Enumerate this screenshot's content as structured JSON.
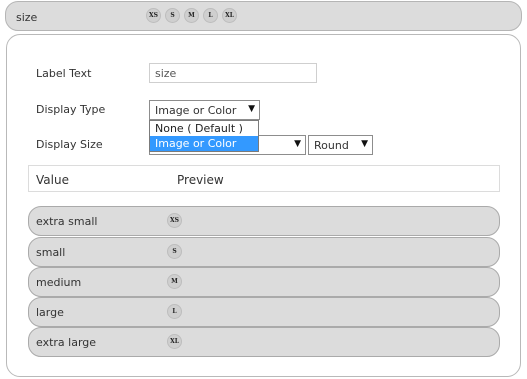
{
  "header": {
    "title": "size",
    "swatches": [
      "XS",
      "S",
      "M",
      "L",
      "XL"
    ]
  },
  "form": {
    "label_text_label": "Label Text",
    "label_text_value": "size",
    "display_type_label": "Display Type",
    "display_type_value": "Image or Color",
    "display_type_options": [
      "None ( Default )",
      "Image or Color"
    ],
    "display_size_label": "Display Size",
    "display_shape_value": "Round"
  },
  "table": {
    "columns": [
      "Value",
      "Preview"
    ],
    "rows": [
      {
        "value": "extra small",
        "preview": "XS"
      },
      {
        "value": "small",
        "preview": "S"
      },
      {
        "value": "medium",
        "preview": "M"
      },
      {
        "value": "large",
        "preview": "L"
      },
      {
        "value": "extra large",
        "preview": "XL"
      }
    ]
  },
  "colors": {
    "highlight": "#3399ff",
    "row_bg": "#dcdcdc",
    "swatch_bg": "#cfcfcf"
  },
  "icons": {
    "dropdown_arrow": "triangle-down-icon"
  }
}
